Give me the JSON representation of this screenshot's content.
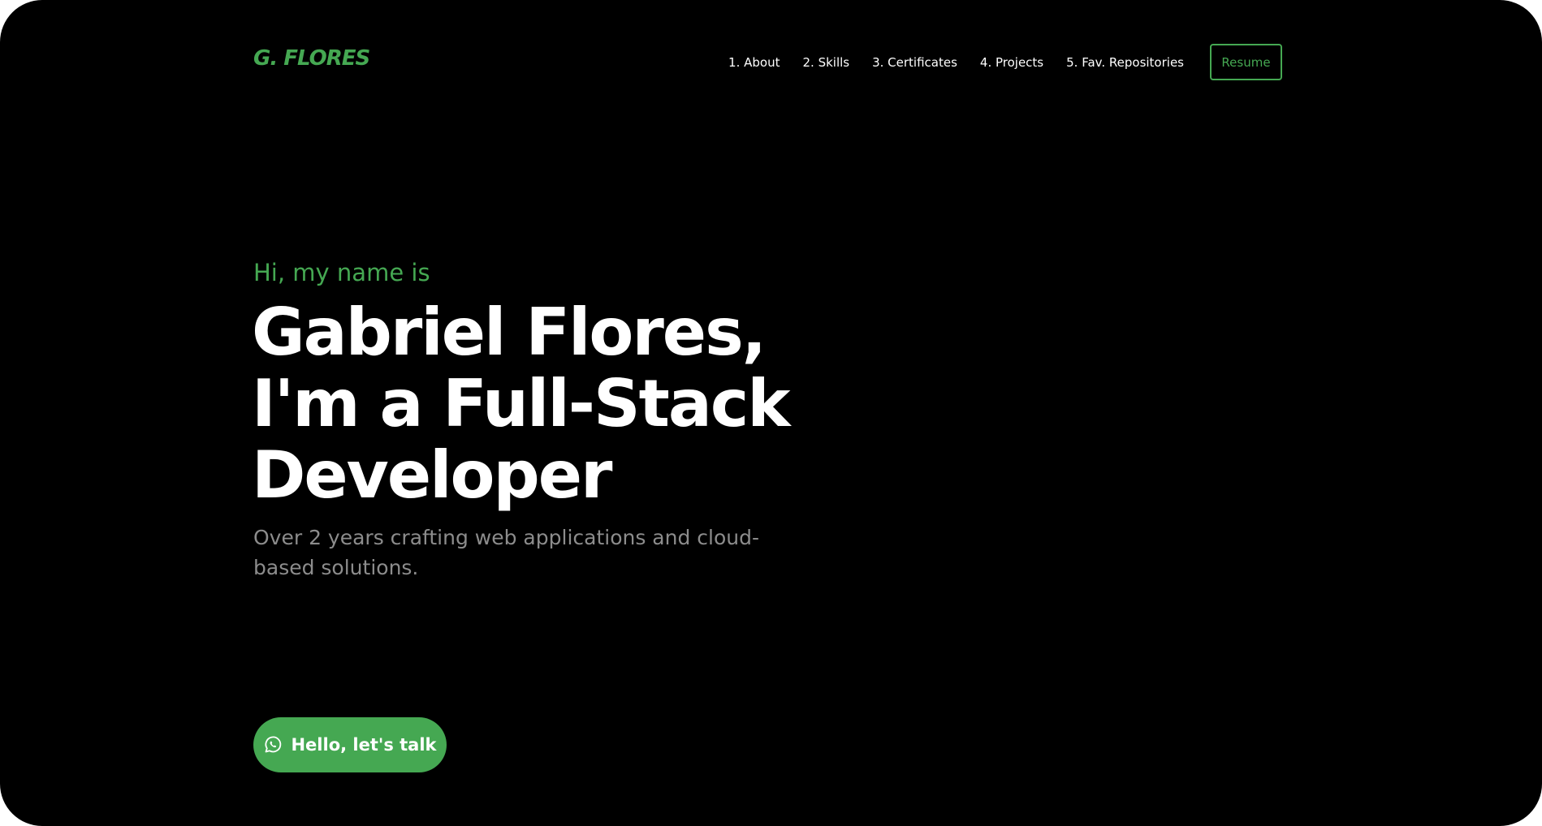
{
  "colors": {
    "background": "#000000",
    "accent": "#45a852",
    "text": "#ffffff",
    "muted": "#8c8c8c"
  },
  "header": {
    "logo": "G. FLORES",
    "nav": [
      {
        "label": "1. About"
      },
      {
        "label": "2. Skills"
      },
      {
        "label": "3. Certificates"
      },
      {
        "label": "4. Projects"
      },
      {
        "label": "5. Fav. Repositories"
      }
    ],
    "resume_label": "Resume"
  },
  "hero": {
    "greeting": "Hi, my name is",
    "headline_lines": [
      "Gabriel Flores,",
      "I'm a Full-Stack",
      "Developer"
    ],
    "subtitle": "Over 2 years crafting web applications and cloud-based solutions.",
    "cta": {
      "label": "Hello, let's talk",
      "icon": "whatsapp-icon"
    }
  }
}
